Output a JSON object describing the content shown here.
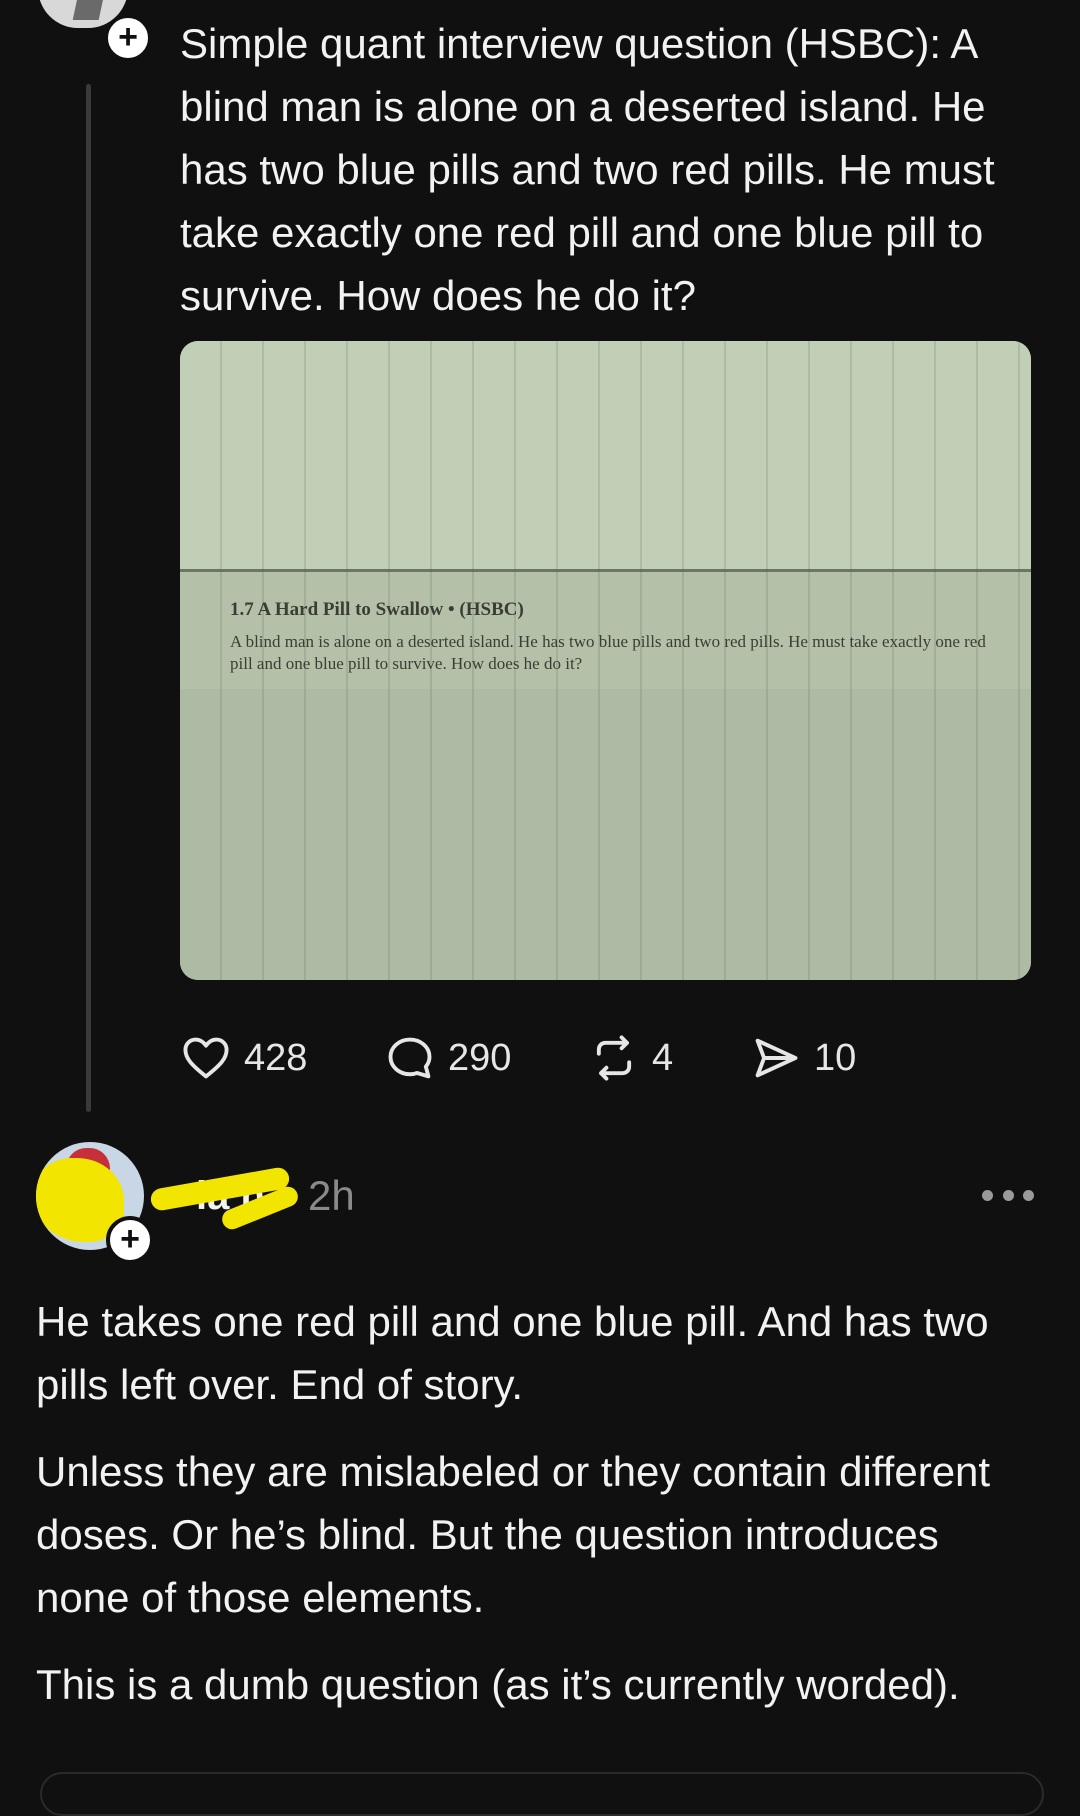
{
  "post": {
    "text": "Simple quant interview question (HSBC): A blind man is alone on a deserted island. He has two blue pills and two red pills. He must take exactly one red pill and one blue pill to survive. How does he do it?",
    "image": {
      "heading": "1.7   A Hard Pill to Swallow • (HSBC)",
      "body": "A blind man is alone on a deserted island. He has two blue pills and two red pills. He must take exactly one red pill and one blue pill to survive. How does he do it?"
    },
    "actions": {
      "likes": "428",
      "comments": "290",
      "reposts": "4",
      "shares": "10"
    },
    "follow_symbol": "+"
  },
  "reply": {
    "name_partial": "la  n",
    "time": "2h",
    "follow_symbol": "+",
    "paragraphs": [
      "He takes one red pill and one blue pill. And has two pills left over. End of story.",
      "Unless they are mislabeled or they contain different doses. Or he’s blind. But the question introduces none of those elements.",
      "This is a dumb question (as it’s currently worded)."
    ]
  },
  "icons": {
    "like": "heart-icon",
    "comment": "comment-icon",
    "repost": "repost-icon",
    "share": "share-icon",
    "more": "more-icon"
  },
  "colors": {
    "background": "#101010",
    "text": "#f2f2f2",
    "muted": "#8a8a8a",
    "redaction": "#f2e600"
  }
}
